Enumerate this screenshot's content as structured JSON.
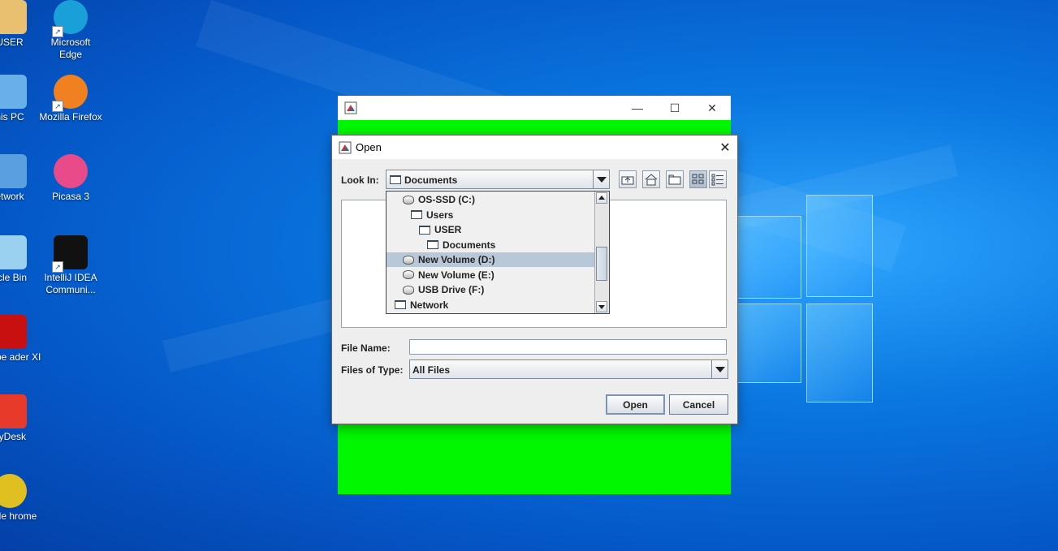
{
  "desktop": {
    "icons": [
      {
        "label": "USER",
        "icon": "user-folder-icon"
      },
      {
        "label": "Microsoft Edge",
        "icon": "edge-icon"
      },
      {
        "label": "his PC",
        "icon": "this-pc-icon"
      },
      {
        "label": "Mozilla Firefox",
        "icon": "firefox-icon"
      },
      {
        "label": "etwork",
        "icon": "network-icon"
      },
      {
        "label": "Picasa 3",
        "icon": "picasa-icon"
      },
      {
        "label": "ycle Bin",
        "icon": "recycle-bin-icon"
      },
      {
        "label": "IntelliJ IDEA Communi...",
        "icon": "intellij-icon"
      },
      {
        "label": "Adobe ader XI",
        "icon": "adobe-reader-icon"
      },
      {
        "label": "nyDesk",
        "icon": "anydesk-icon"
      },
      {
        "label": "oogle hrome",
        "icon": "chrome-icon"
      }
    ]
  },
  "frame": {
    "title_controls": [
      "—",
      "☐",
      "✕"
    ],
    "background_color": "#00f700"
  },
  "dialog": {
    "title": "Open",
    "look_in_label": "Look In:",
    "look_in_value": "Documents",
    "dropdown_items": [
      {
        "label": "OS-SSD (C:)",
        "type": "drive",
        "indent": 1,
        "selected": false
      },
      {
        "label": "Users",
        "type": "folder",
        "indent": 2,
        "selected": false
      },
      {
        "label": "USER",
        "type": "folder",
        "indent": 3,
        "selected": false
      },
      {
        "label": "Documents",
        "type": "folder",
        "indent": 4,
        "selected": false
      },
      {
        "label": "New Volume (D:)",
        "type": "drive",
        "indent": 1,
        "selected": true
      },
      {
        "label": "New Volume (E:)",
        "type": "drive",
        "indent": 1,
        "selected": false
      },
      {
        "label": "USB Drive (F:)",
        "type": "drive",
        "indent": 1,
        "selected": false
      },
      {
        "label": "Network",
        "type": "folder",
        "indent": 0,
        "selected": false
      }
    ],
    "toolbar": [
      "up-one-level-icon",
      "home-icon",
      "new-folder-icon",
      "list-view-icon",
      "details-view-icon"
    ],
    "file_name_label": "File Name:",
    "file_name_value": "",
    "files_of_type_label": "Files of Type:",
    "files_of_type_value": "All Files",
    "open_label": "Open",
    "cancel_label": "Cancel"
  }
}
